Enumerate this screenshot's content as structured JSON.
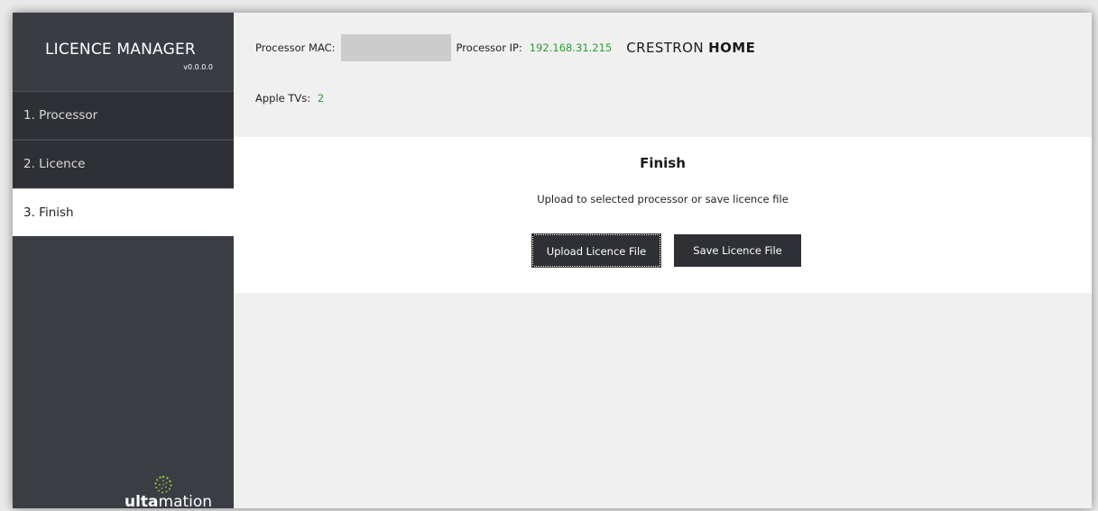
{
  "app": {
    "title": "LICENCE MANAGER",
    "version": "v0.0.0.0"
  },
  "sidebar": {
    "items": [
      {
        "label": "1. Processor",
        "active": false
      },
      {
        "label": "2. Licence",
        "active": false
      },
      {
        "label": "3. Finish",
        "active": true
      }
    ],
    "logo": {
      "bold": "ulta",
      "regular": "mation",
      "icon": "spiral-dots-icon"
    }
  },
  "header": {
    "mac_label": "Processor MAC:",
    "mac_value": "",
    "ip_label": "Processor IP:",
    "ip_value": "192.168.31.215",
    "brand_regular": "CRESTRON",
    "brand_bold": "HOME",
    "appletv_label": "Apple TVs:",
    "appletv_value": "2"
  },
  "finish": {
    "title": "Finish",
    "subtitle": "Upload to selected processor or save licence file",
    "upload_label": "Upload Licence File",
    "save_label": "Save Licence File"
  },
  "colors": {
    "sidebar_bg": "#3a3d44",
    "nav_bg": "#2e3035",
    "accent_green": "#2e9a3a",
    "button_bg": "#2e3035"
  }
}
